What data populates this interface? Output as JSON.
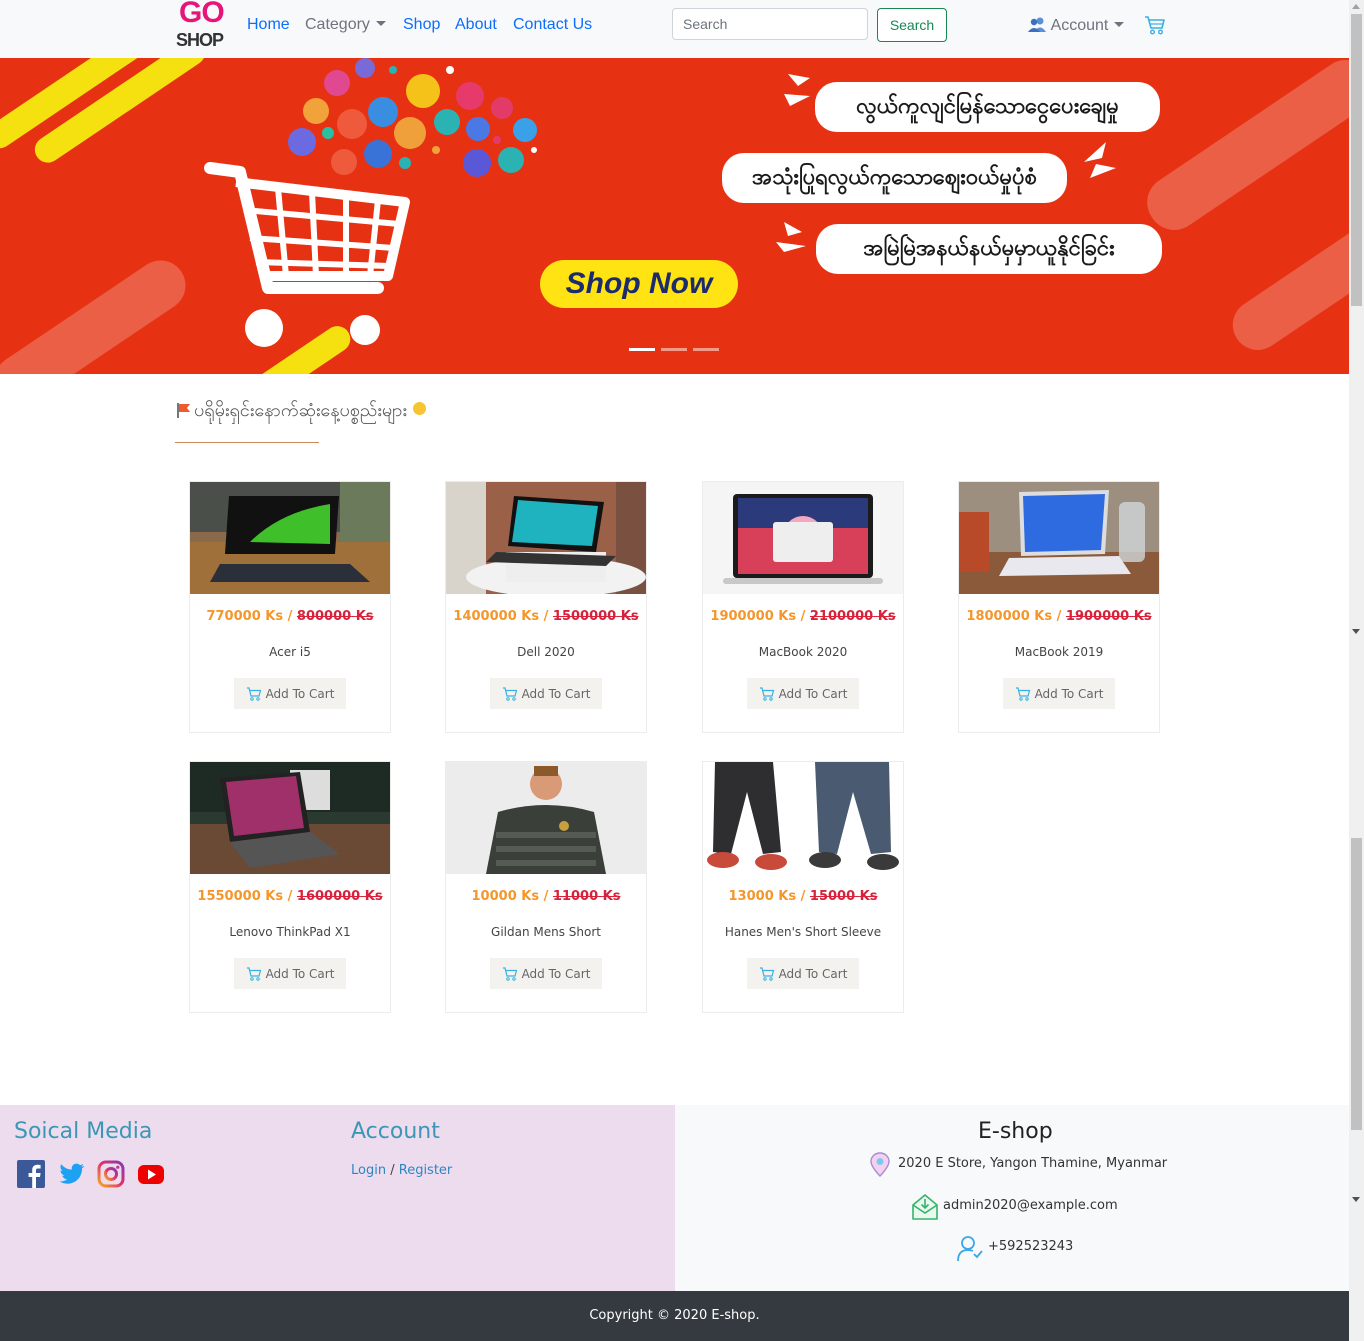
{
  "nav": {
    "logo_top": "GO",
    "logo_bottom": "SHOP",
    "home": "Home",
    "category": "Category",
    "shop": "Shop",
    "about": "About",
    "contact": "Contact Us",
    "search_placeholder": "Search",
    "search_button": "Search",
    "account": "Account"
  },
  "banner": {
    "lines": [
      "လွယ်ကူလျင်မြန်သောငွေပေးချေမှု",
      "အသုံးပြုရလွယ်ကူသောဈေးဝယ်မှုပုံစံ",
      "အမြဲမြဲအနယ်နယ်မှမှာယူနိုင်ခြင်း"
    ],
    "cta": "Shop Now",
    "slides": 3,
    "active_slide": 1,
    "color": "#e63212"
  },
  "section": {
    "title": "ပရိုမိုးရှင်းနောက်ဆုံးနေ့ပစ္စည်းများ"
  },
  "currency": "Ks",
  "add_to_cart_label": "Add To Cart",
  "products": [
    {
      "name": "Acer i5",
      "price": "770000",
      "old_price": "800000"
    },
    {
      "name": "Dell 2020",
      "price": "1400000",
      "old_price": "1500000"
    },
    {
      "name": "MacBook 2020",
      "price": "1900000",
      "old_price": "2100000"
    },
    {
      "name": "MacBook 2019",
      "price": "1800000",
      "old_price": "1900000"
    },
    {
      "name": "Lenovo ThinkPad X1",
      "price": "1550000",
      "old_price": "1600000"
    },
    {
      "name": "Gildan Mens Short",
      "price": "10000",
      "old_price": "11000"
    },
    {
      "name": "Hanes Men's Short Sleeve",
      "price": "13000",
      "old_price": "15000"
    }
  ],
  "footer": {
    "social_heading": "Soical Media",
    "social_icons": [
      "facebook-icon",
      "twitter-icon",
      "instagram-icon",
      "youtube-icon"
    ],
    "account_heading": "Account",
    "login": "Login",
    "separator": "/",
    "register": "Register",
    "brand": "E-shop",
    "address": "2020 E Store, Yangon Thamine, Myanmar",
    "email": "admin2020@example.com",
    "phone": "+592523243",
    "copyright": "Copyright © 2020 E-shop."
  }
}
